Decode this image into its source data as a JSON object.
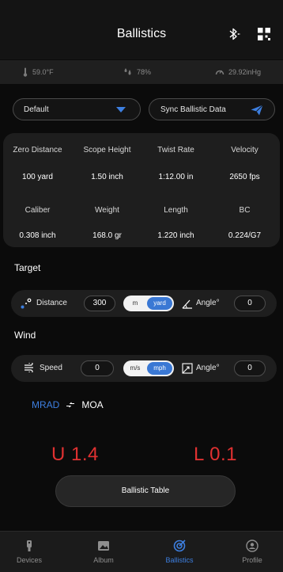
{
  "header": {
    "title": "Ballistics"
  },
  "env": {
    "temperature": "59.0°F",
    "humidity": "78%",
    "pressure": "29.92inHg"
  },
  "profile_select": {
    "value": "Default"
  },
  "sync_button": {
    "label": "Sync Ballistic Data"
  },
  "params": {
    "row1": [
      {
        "label": "Zero Distance",
        "value": "100 yard"
      },
      {
        "label": "Scope Height",
        "value": "1.50 inch"
      },
      {
        "label": "Twist Rate",
        "value": "1:12.00 in"
      },
      {
        "label": "Velocity",
        "value": "2650 fps"
      }
    ],
    "row2": [
      {
        "label": "Caliber",
        "value": "0.308 inch"
      },
      {
        "label": "Weight",
        "value": "168.0 gr"
      },
      {
        "label": "Length",
        "value": "1.220 inch"
      },
      {
        "label": "BC",
        "value": "0.224/G7"
      }
    ]
  },
  "target": {
    "title": "Target",
    "distance_label": "Distance",
    "distance_value": "300",
    "unit_a": "m",
    "unit_b": "yard",
    "angle_label": "Angle°",
    "angle_value": "0"
  },
  "wind": {
    "title": "Wind",
    "speed_label": "Speed",
    "speed_value": "0",
    "unit_a": "m/s",
    "unit_b": "mph",
    "angle_label": "Angle°",
    "angle_value": "0"
  },
  "units": {
    "primary": "MRAD",
    "secondary": "MOA"
  },
  "adjustment": {
    "elevation": "U 1.4",
    "windage": "L 0.1"
  },
  "ballistic_table_button": {
    "label": "Ballistic Table"
  },
  "tabs": [
    {
      "label": "Devices",
      "active": false
    },
    {
      "label": "Album",
      "active": false
    },
    {
      "label": "Ballistics",
      "active": true
    },
    {
      "label": "Profile",
      "active": false
    }
  ],
  "colors": {
    "accent": "#3d7fe0",
    "alert": "#e03131",
    "background": "#0b0b0b",
    "card": "#1e1e1e"
  }
}
